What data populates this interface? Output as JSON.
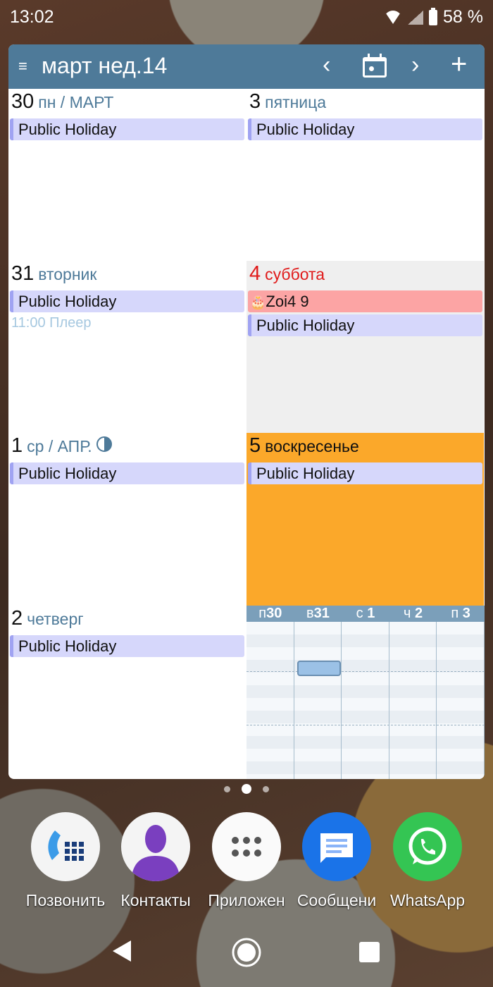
{
  "status_bar": {
    "time": "13:02",
    "battery": "58 %"
  },
  "header": {
    "menu_icon": "≡",
    "title": "март нед.14",
    "prev": "‹",
    "next": "›",
    "add": "+"
  },
  "days": [
    {
      "num": "30",
      "label": "пн / МАРТ",
      "events": [
        "Public Holiday"
      ]
    },
    {
      "num": "3",
      "label": "пятница",
      "events": [
        "Public Holiday"
      ]
    },
    {
      "num": "31",
      "label": "вторник",
      "events": [
        "Public Holiday"
      ],
      "timed": "11:00 Плеер"
    },
    {
      "num": "4",
      "label": "суббота",
      "birthday": "Zoi4 9",
      "events": [
        "Public Holiday"
      ]
    },
    {
      "num": "1",
      "label": "ср / АПР.",
      "events": [
        "Public Holiday"
      ]
    },
    {
      "num": "5",
      "label": "воскресенье",
      "events": [
        "Public Holiday"
      ]
    },
    {
      "num": "2",
      "label": "четверг",
      "events": [
        "Public Holiday"
      ]
    }
  ],
  "mini_week": [
    {
      "day": "п",
      "num": "30"
    },
    {
      "day": "в",
      "num": "31"
    },
    {
      "day": "с ",
      "num": "1"
    },
    {
      "day": "ч ",
      "num": "2"
    },
    {
      "day": "п ",
      "num": "3"
    }
  ],
  "colors": {
    "header": "#4e7a99",
    "saturday_bg": "#efefef",
    "sunday_bg": "#fba82a",
    "weekend_text": "#e01b1b",
    "holiday_event": "#d6d7fb",
    "birthday_event": "#fca4a4"
  },
  "dock": [
    {
      "label": "Позвонить"
    },
    {
      "label": "Контакты"
    },
    {
      "label": "Приложен"
    },
    {
      "label": "Сообщени"
    },
    {
      "label": "WhatsApp"
    }
  ]
}
